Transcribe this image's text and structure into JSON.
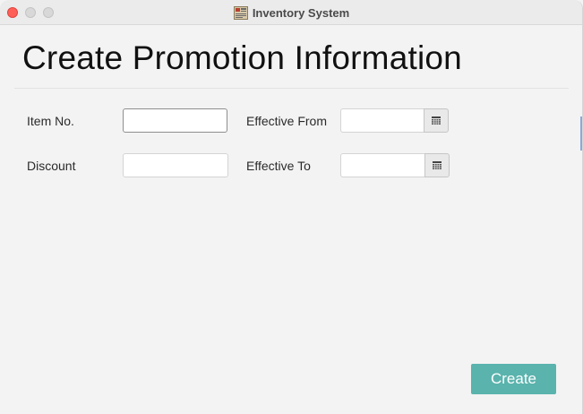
{
  "window": {
    "title": "Inventory System"
  },
  "page": {
    "heading": "Create Promotion Information"
  },
  "form": {
    "item_no": {
      "label": "Item No.",
      "value": ""
    },
    "discount": {
      "label": "Discount",
      "value": ""
    },
    "effective_from": {
      "label": "Effective From",
      "value": ""
    },
    "effective_to": {
      "label": "Effective To",
      "value": ""
    }
  },
  "actions": {
    "create_label": "Create"
  },
  "colors": {
    "accent": "#5ab3ad",
    "close": "#fe5f57"
  },
  "icons": {
    "app": "inventory-app-icon",
    "calendar": "calendar-icon"
  }
}
